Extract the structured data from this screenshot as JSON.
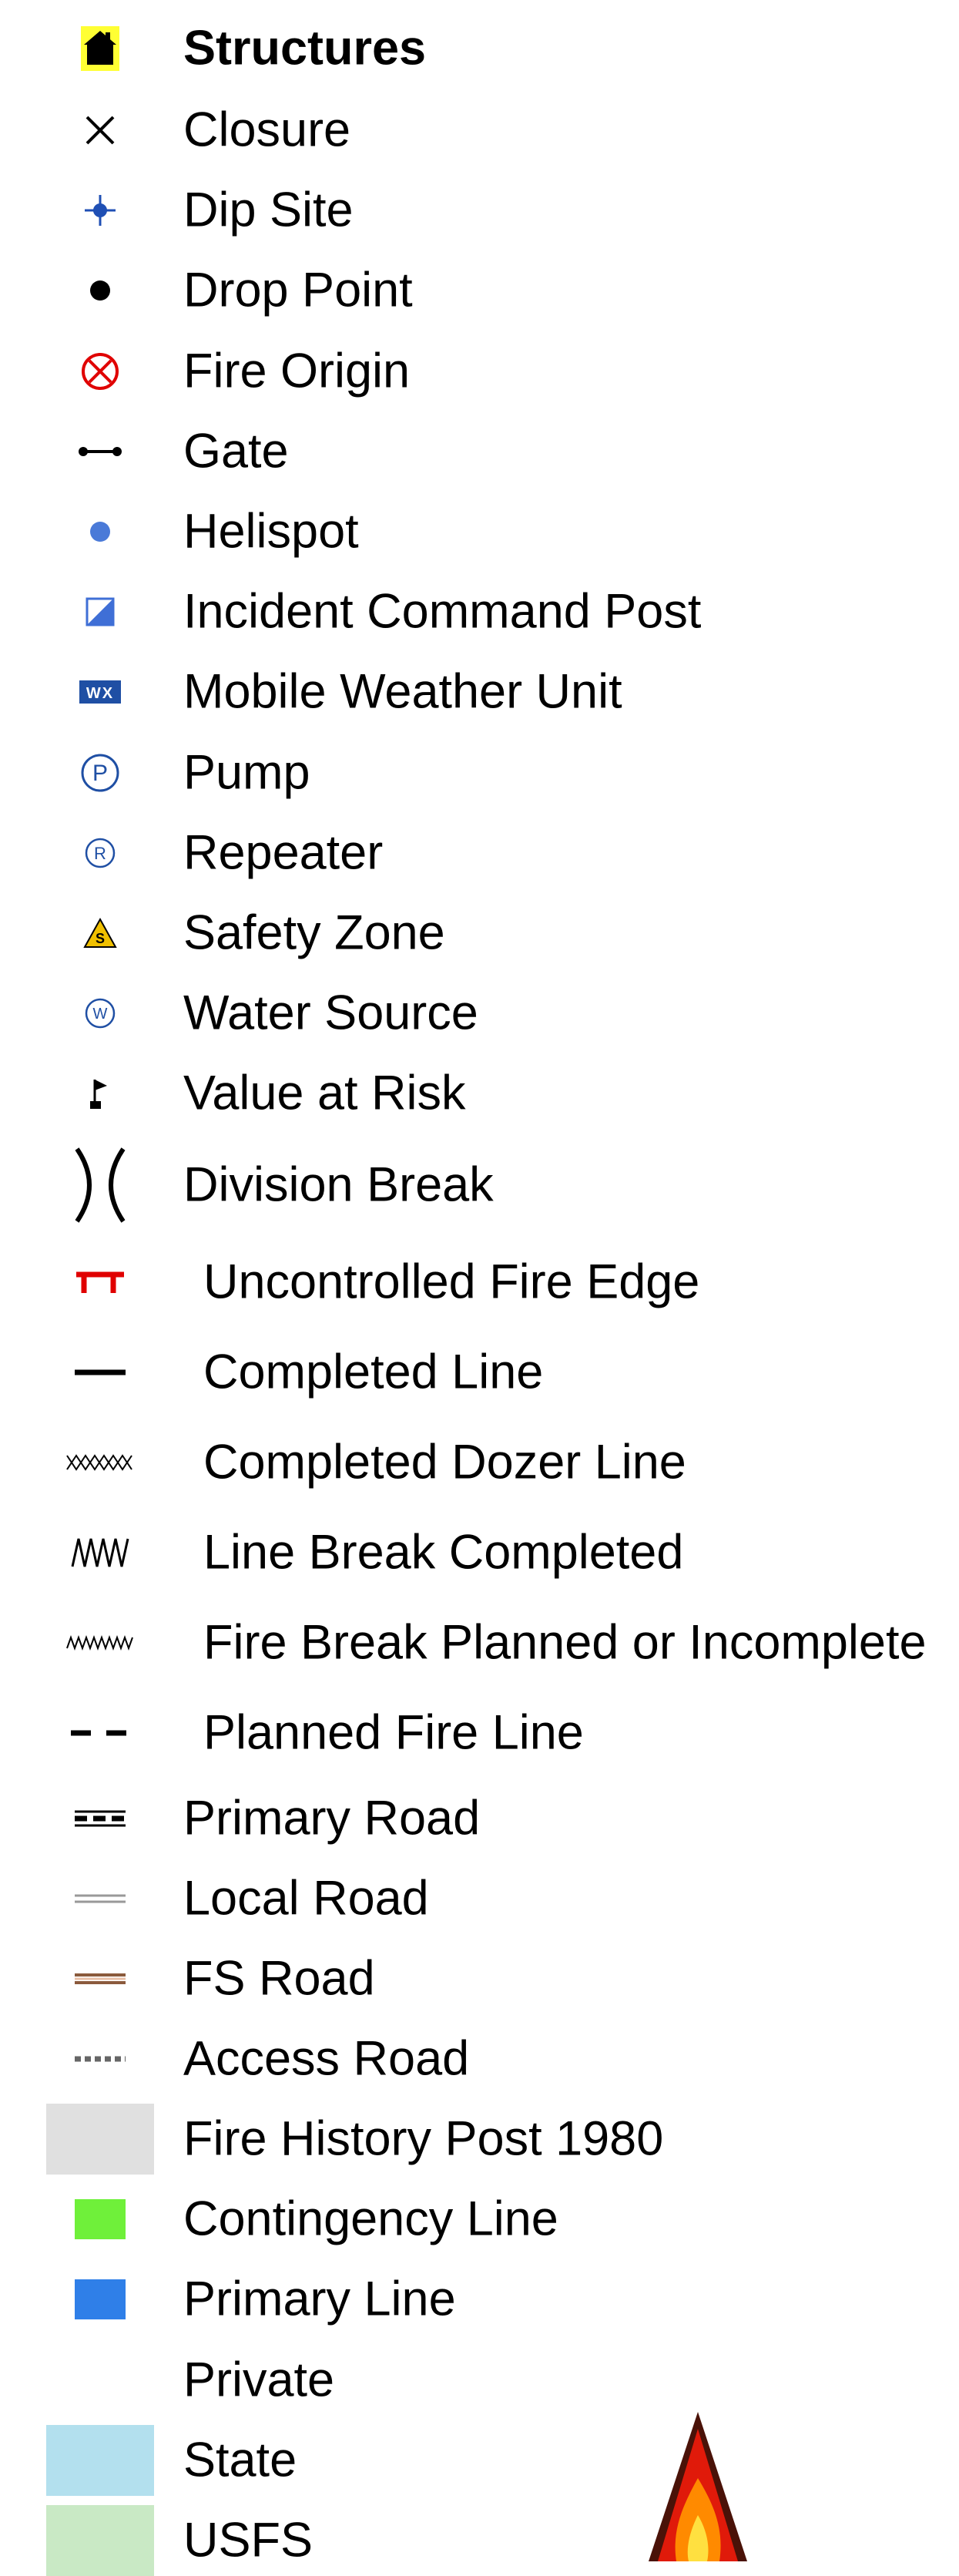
{
  "legend": {
    "items": [
      {
        "label": "Structures",
        "icon": "house-icon",
        "color": "#000000",
        "highlight": "#ffff33"
      },
      {
        "label": "Closure",
        "icon": "x-cross-icon",
        "color": "#000000"
      },
      {
        "label": "Dip Site",
        "icon": "crosshair-dot-icon",
        "color": "#1f4fb4"
      },
      {
        "label": "Drop Point",
        "icon": "black-dot-icon",
        "color": "#000000"
      },
      {
        "label": "Fire Origin",
        "icon": "circled-x-icon",
        "color": "#e00000"
      },
      {
        "label": "Gate",
        "icon": "gate-icon",
        "color": "#000000"
      },
      {
        "label": "Helispot",
        "icon": "blue-dot-icon",
        "color": "#4a7ad8"
      },
      {
        "label": "Incident Command Post",
        "icon": "command-post-icon",
        "color": "#3f6fd6"
      },
      {
        "label": "Mobile Weather Unit",
        "icon": "weather-unit-icon",
        "color": "#1f4fa4",
        "icon_text": "WX"
      },
      {
        "label": "Pump",
        "icon": "circled-p-icon",
        "color": "#1f4fa4",
        "icon_text": "P"
      },
      {
        "label": "Repeater",
        "icon": "circled-r-icon",
        "color": "#1f4fa4",
        "icon_text": "R"
      },
      {
        "label": "Safety Zone",
        "icon": "safety-triangle-icon",
        "color": "#f0c000",
        "icon_text": "S"
      },
      {
        "label": "Water Source",
        "icon": "circled-w-icon",
        "color": "#1f4fa4",
        "icon_text": "W"
      },
      {
        "label": "Value at Risk",
        "icon": "flag-icon",
        "color": "#000000"
      },
      {
        "label": "Division Break",
        "icon": "division-break-icon",
        "color": "#000000"
      },
      {
        "label": "Uncontrolled Fire Edge",
        "icon": "uncontrolled-edge-icon",
        "color": "#e00000"
      },
      {
        "label": "Completed Line",
        "icon": "solid-line-icon",
        "color": "#000000"
      },
      {
        "label": "Completed Dozer Line",
        "icon": "dozer-line-icon",
        "color": "#000000"
      },
      {
        "label": "Line Break Completed",
        "icon": "zigzag-line-icon",
        "color": "#000000"
      },
      {
        "label": "Fire Break Planned or Incomplete",
        "icon": "wavy-line-icon",
        "color": "#000000"
      },
      {
        "label": "Planned Fire Line",
        "icon": "dashed-line-icon",
        "color": "#000000"
      },
      {
        "label": "Primary Road",
        "icon": "primary-road-icon",
        "color": "#000000"
      },
      {
        "label": "Local Road",
        "icon": "local-road-icon",
        "color": "#999999"
      },
      {
        "label": "FS Road",
        "icon": "fs-road-icon",
        "color": "#8b5a3c"
      },
      {
        "label": "Access Road",
        "icon": "access-road-icon",
        "color": "#666666"
      },
      {
        "label": "Fire History Post 1980",
        "icon": "gray-swatch-icon",
        "color": "#e0e0e0"
      },
      {
        "label": "Contingency Line",
        "icon": "green-swatch-icon",
        "color": "#6ff03a"
      },
      {
        "label": "Primary Line",
        "icon": "blue-swatch-icon",
        "color": "#2f7fe8"
      },
      {
        "label": "Private",
        "icon": "empty-swatch-icon",
        "color": "#ffffff"
      },
      {
        "label": "State",
        "icon": "light-blue-swatch-icon",
        "color": "#b3e0ee"
      },
      {
        "label": "USFS",
        "icon": "light-green-swatch-icon",
        "color": "#c9e9c5"
      }
    ],
    "flame_icon": "fire-arrow-icon"
  }
}
